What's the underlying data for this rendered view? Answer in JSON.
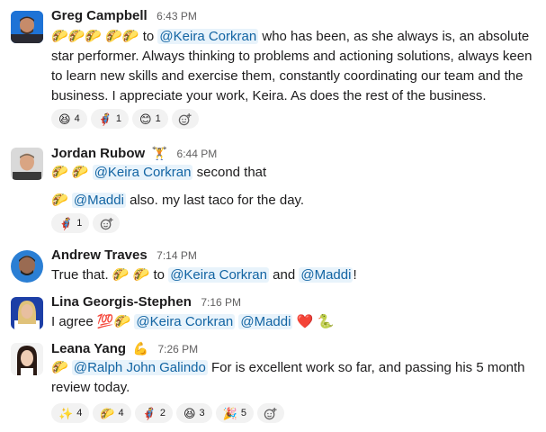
{
  "messages": [
    {
      "name": "Greg Campbell",
      "time": "6:43 PM",
      "emojis": "🌮🌮🌮 🌮🌮",
      "pre": " to ",
      "mention": "@Keira Corkran",
      "post": " who has been, as she always is, an absolute star performer. Always thinking to problems and actioning solutions, always keen to learn new skills and exercise them, constantly coordinating our team and the business. I appreciate your work, Keira. As does the rest of the business.",
      "reactions": [
        {
          "emoji": "😆",
          "count": "4"
        },
        {
          "emoji": "🦸",
          "count": "1"
        },
        {
          "emoji": "😊",
          "count": "1"
        }
      ]
    },
    {
      "name": "Jordan Rubow",
      "status": "🏋️",
      "time": "6:44 PM",
      "line1_emojis": "🌮 🌮",
      "line1_mention": "@Keira Corkran",
      "line1_post": " second that",
      "line2_emoji": "🌮",
      "line2_mention": "@Maddi",
      "line2_post": " also. my last taco for the day.",
      "reactions": [
        {
          "emoji": "🦸",
          "count": "1"
        }
      ]
    },
    {
      "name": "Andrew Traves",
      "time": "7:14 PM",
      "pre": "True that. ",
      "emojis": "🌮 🌮",
      "mid": " to ",
      "mention1": "@Keira Corkran",
      "and": " and ",
      "mention2": "@Maddi",
      "post": "!"
    },
    {
      "name": "Lina Georgis-Stephen",
      "time": "7:16 PM",
      "pre": "I agree ",
      "emojis": "💯🌮",
      "mention1": "@Keira Corkran",
      "mention2": "@Maddi",
      "heart": "❤️",
      "tail": "🐍"
    },
    {
      "name": "Leana Yang",
      "status": "💪",
      "time": "7:26 PM",
      "emoji": "🌮",
      "mention": "@Ralph John Galindo",
      "post": " For is excellent work so far, and passing his 5 month review today.",
      "reactions": [
        {
          "emoji": "✨",
          "count": "4"
        },
        {
          "emoji": "🌮",
          "count": "4"
        },
        {
          "emoji": "🦸",
          "count": "2"
        },
        {
          "emoji": "😆",
          "count": "3"
        },
        {
          "emoji": "🎉",
          "count": "5"
        }
      ]
    }
  ],
  "add_reaction_icon": "add-reaction-icon"
}
